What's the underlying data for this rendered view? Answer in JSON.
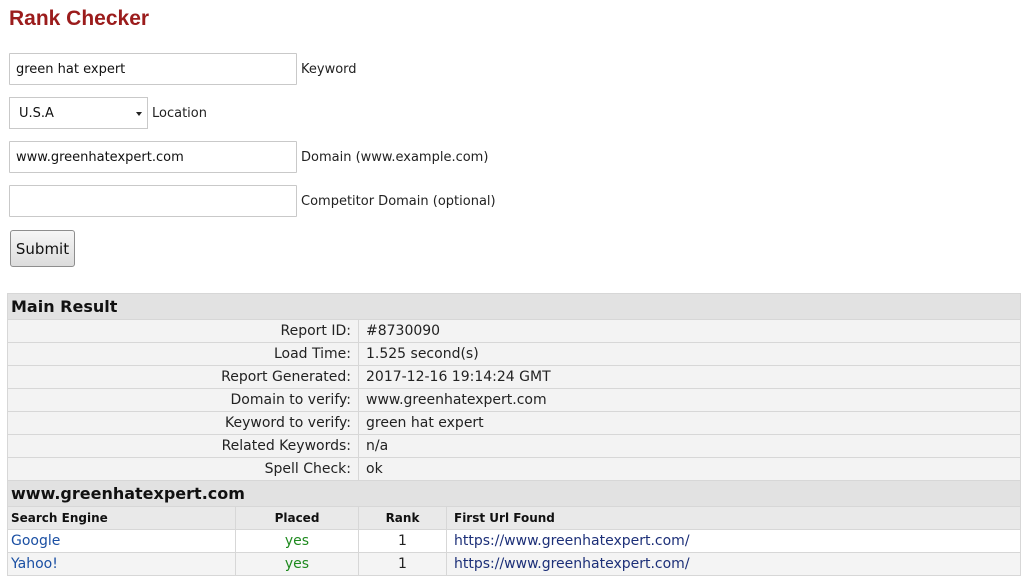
{
  "page_title": "Rank Checker",
  "form": {
    "keyword": {
      "value": "green hat expert",
      "label": "Keyword"
    },
    "location": {
      "selected": "U.S.A",
      "label": "Location"
    },
    "domain": {
      "value": "www.greenhatexpert.com",
      "label": "Domain (www.example.com)"
    },
    "competitor": {
      "value": "",
      "label": "Competitor Domain (optional)"
    },
    "submit_label": "Submit"
  },
  "main_result": {
    "heading": "Main Result",
    "rows": [
      {
        "key": "Report ID:",
        "value": "#8730090"
      },
      {
        "key": "Load Time:",
        "value": "1.525 second(s)"
      },
      {
        "key": "Report Generated:",
        "value": "2017-12-16 19:14:24 GMT"
      },
      {
        "key": "Domain to verify:",
        "value": "www.greenhatexpert.com"
      },
      {
        "key": "Keyword to verify:",
        "value": "green hat expert"
      },
      {
        "key": "Related Keywords:",
        "value": "n/a"
      },
      {
        "key": "Spell Check:",
        "value": "ok"
      }
    ]
  },
  "engines": {
    "heading": "www.greenhatexpert.com",
    "columns": [
      "Search Engine",
      "Placed",
      "Rank",
      "First Url Found"
    ],
    "rows": [
      {
        "engine": "Google",
        "placed": "yes",
        "rank": "1",
        "url": "https://www.greenhatexpert.com/"
      },
      {
        "engine": "Yahoo!",
        "placed": "yes",
        "rank": "1",
        "url": "https://www.greenhatexpert.com/"
      }
    ]
  },
  "colors": {
    "title": "#9b1c1c",
    "ok_green": "#1f8a1f",
    "link_blue": "#1a4fa3"
  }
}
